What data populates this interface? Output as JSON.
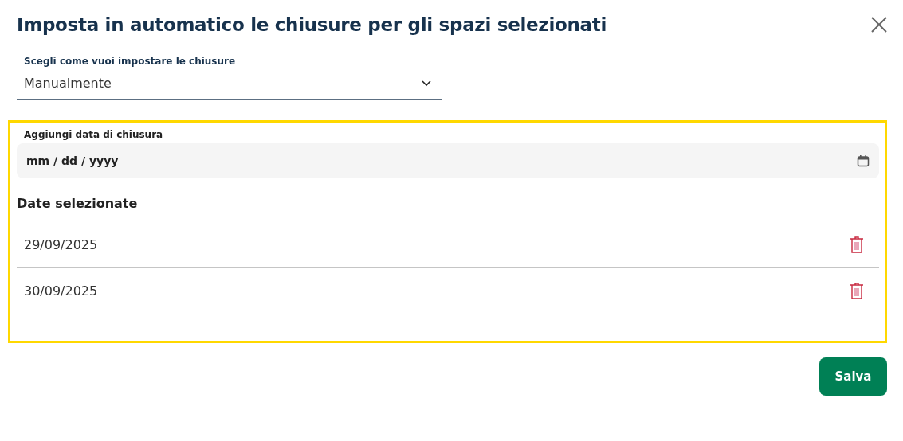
{
  "dialog": {
    "title": "Imposta in automatico le chiusure per gli spazi selezionati"
  },
  "mode_select": {
    "label": "Scegli come vuoi impostare le chiusure",
    "value": "Manualmente"
  },
  "closure_section": {
    "highlighted": true,
    "date_label": "Aggiungi data di chiusura",
    "date_placeholder": "mm / dd / yyyy",
    "list_title": "Date selezionate",
    "dates": [
      {
        "value": "29/09/2025"
      },
      {
        "value": "30/09/2025"
      }
    ]
  },
  "buttons": [
    {
      "label": "Salva"
    }
  ]
}
